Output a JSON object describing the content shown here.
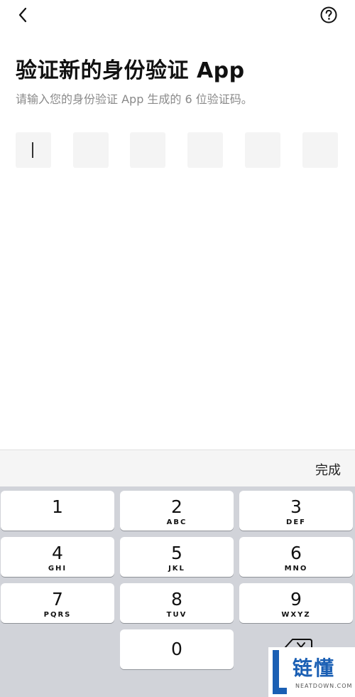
{
  "header": {
    "back_icon": "chevron-left-icon",
    "help_icon": "question-circle-icon"
  },
  "title": "验证新的身份验证 App",
  "subtitle": "请输入您的身份验证 App 生成的 6 位验证码。",
  "otp": {
    "length": 6,
    "focused_index": 0
  },
  "done_label": "完成",
  "keyboard": {
    "keys": [
      {
        "digit": "1",
        "letters": ""
      },
      {
        "digit": "2",
        "letters": "ABC"
      },
      {
        "digit": "3",
        "letters": "DEF"
      },
      {
        "digit": "4",
        "letters": "GHI"
      },
      {
        "digit": "5",
        "letters": "JKL"
      },
      {
        "digit": "6",
        "letters": "MNO"
      },
      {
        "digit": "7",
        "letters": "PQRS"
      },
      {
        "digit": "8",
        "letters": "TUV"
      },
      {
        "digit": "9",
        "letters": "WXYZ"
      },
      {
        "digit": "0",
        "letters": ""
      }
    ],
    "backspace_icon": "backspace-icon"
  },
  "watermark": {
    "text": "链懂",
    "sub": "NEATDOWN.COM"
  }
}
